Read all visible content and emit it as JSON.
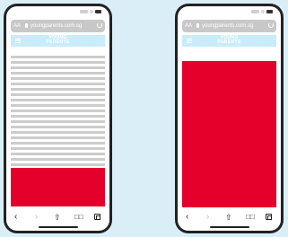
{
  "colors": {
    "background": "#daeef8",
    "phone_frame": "#222222",
    "ad_red": "#e5002b",
    "header_blue": "#c9ecfb",
    "text_placeholder": "#cccccc"
  },
  "browser": {
    "aa_label": "AA",
    "url": "youngparents.com.sg",
    "reload_icon": "reload-icon"
  },
  "site": {
    "logo_line1": "YOUNG",
    "logo_line2": "PARENTS",
    "menu_icon": "hamburger-menu-icon"
  },
  "toolbar": {
    "back": "‹",
    "forward": "›",
    "share": "⇧",
    "bookmarks": "□□",
    "tabs_icon": "tabs-icon"
  }
}
